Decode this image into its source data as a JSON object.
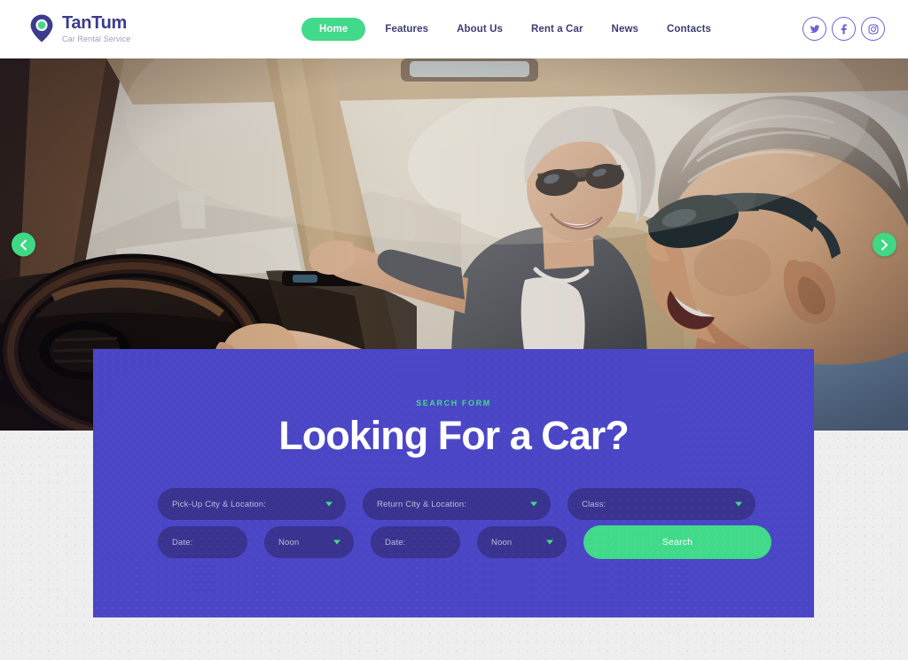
{
  "brand": {
    "name": "TanTum",
    "tagline": "Car Rental Service",
    "logo_icon": "location-pin-icon",
    "primary_color": "#4b46c6",
    "accent_color": "#41d98a",
    "logo_color": "#3c3b8e"
  },
  "nav": {
    "items": [
      {
        "label": "Home",
        "active": true
      },
      {
        "label": "Features",
        "active": false
      },
      {
        "label": "About Us",
        "active": false
      },
      {
        "label": "Rent a Car",
        "active": false
      },
      {
        "label": "News",
        "active": false
      },
      {
        "label": "Contacts",
        "active": false
      }
    ]
  },
  "socials": [
    {
      "name": "twitter-icon",
      "label": "Twitter"
    },
    {
      "name": "facebook-icon",
      "label": "Facebook"
    },
    {
      "name": "instagram-icon",
      "label": "Instagram"
    }
  ],
  "hero": {
    "alt": "Senior couple driving in a convertible car, man at the steering wheel wearing sunglasses, smiling woman in the passenger seat",
    "prev_arrow_icon": "chevron-left-icon",
    "next_arrow_icon": "chevron-right-icon"
  },
  "search": {
    "eyebrow": "SEARCH FORM",
    "title": "Looking For a Car?",
    "fields": {
      "pickup": {
        "label": "Pick-Up City & Location:",
        "caret": true
      },
      "return": {
        "label": "Return City & Location:",
        "caret": true
      },
      "class": {
        "label": "Class:",
        "caret": true
      },
      "pickup_date": {
        "label": "Date:",
        "caret": false
      },
      "pickup_time": {
        "label": "Noon",
        "caret": true
      },
      "return_date": {
        "label": "Date:",
        "caret": false
      },
      "return_time": {
        "label": "Noon",
        "caret": true
      }
    },
    "submit_label": "Search"
  }
}
